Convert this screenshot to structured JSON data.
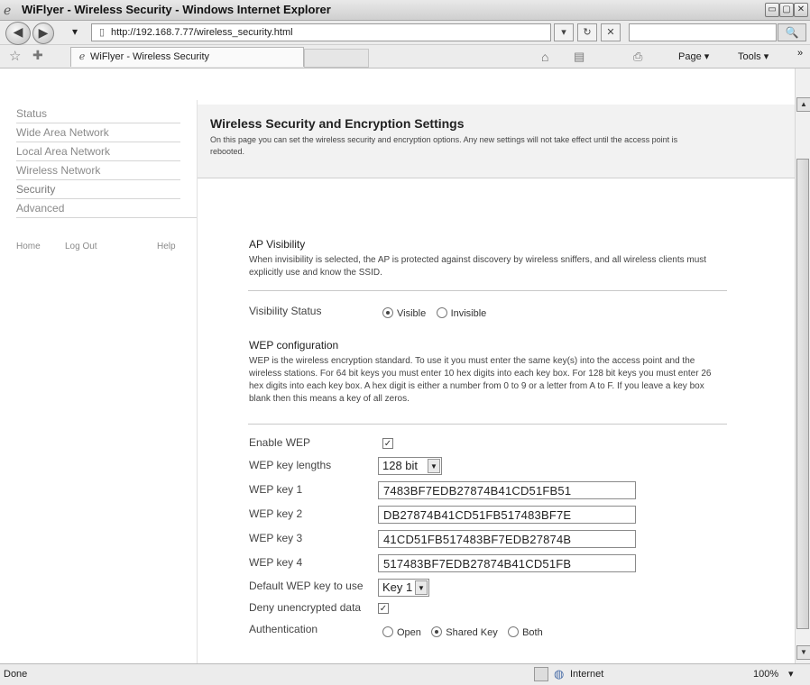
{
  "window": {
    "title": "WiFlyer - Wireless Security - Windows Internet Explorer",
    "min": "▭",
    "max": "▢",
    "close": "✕"
  },
  "address_bar": {
    "back": "◀",
    "forward": "▶",
    "dropdown": "▾",
    "url": "http://192.168.7.77/wireless_security.html",
    "refresh": "↻",
    "stop": "✕",
    "search_button": "🔍"
  },
  "tab_bar": {
    "favorites": "☆",
    "add_favorites": "✚",
    "tab_title": "WiFlyer - Wireless Security",
    "home_icon": "⌂",
    "feeds_icon": "▤",
    "print_icon": "⎙",
    "page_menu": "Page ▾",
    "tools_menu": "Tools ▾",
    "more": "»"
  },
  "sidebar": {
    "items": [
      {
        "label": "Status"
      },
      {
        "label": "Wide Area Network"
      },
      {
        "label": "Local Area Network"
      },
      {
        "label": "Wireless Network"
      },
      {
        "label": "Security"
      },
      {
        "label": "Advanced"
      }
    ],
    "links": [
      "Home",
      "Log Out",
      "Help"
    ]
  },
  "header": {
    "title": "Wireless Security and Encryption Settings",
    "description": "On this page you can set the wireless security and encryption options. Any new settings will not take effect until the access point is rebooted."
  },
  "ap_visibility": {
    "title": "AP Visibility",
    "text": "When invisibility is selected, the AP is protected against discovery by wireless sniffers, and all wireless clients must explicitly use and know the SSID.",
    "status_label": "Visibility Status",
    "options": [
      "Visible",
      "Invisible"
    ],
    "selected": "Visible"
  },
  "wep": {
    "title": "WEP configuration",
    "text": "WEP is the wireless encryption standard. To use it you must enter the same key(s) into the access point and the wireless stations. For 64 bit keys you must enter 10 hex digits into each key box. For 128 bit keys you must enter 26 hex digits into each key box. A hex digit is either a number from 0 to 9 or a letter from A to F. If you leave a key box blank then this means a key of all zeros.",
    "enable_label": "Enable WEP",
    "enable_checked": true,
    "key_length_label": "WEP key lengths",
    "key_length_value": "128 bit",
    "keys": [
      {
        "label": "WEP key 1",
        "value": "7483BF7EDB27874B41CD51FB51"
      },
      {
        "label": "WEP key 2",
        "value": "DB27874B41CD51FB517483BF7E"
      },
      {
        "label": "WEP key 3",
        "value": "41CD51FB517483BF7EDB27874B"
      },
      {
        "label": "WEP key 4",
        "value": "517483BF7EDB27874B41CD51FB"
      }
    ],
    "default_key_label": "Default WEP key to use",
    "default_key_value": "Key 1",
    "deny_label": "Deny unencrypted data",
    "deny_checked": true,
    "auth_label": "Authentication",
    "auth_options": [
      "Open",
      "Shared Key",
      "Both"
    ],
    "auth_selected": "Shared Key",
    "check_mark": "✓"
  },
  "status_bar": {
    "text": "Done",
    "zone": "Internet",
    "zoom": "100%",
    "zoom_arrow": "▾"
  }
}
